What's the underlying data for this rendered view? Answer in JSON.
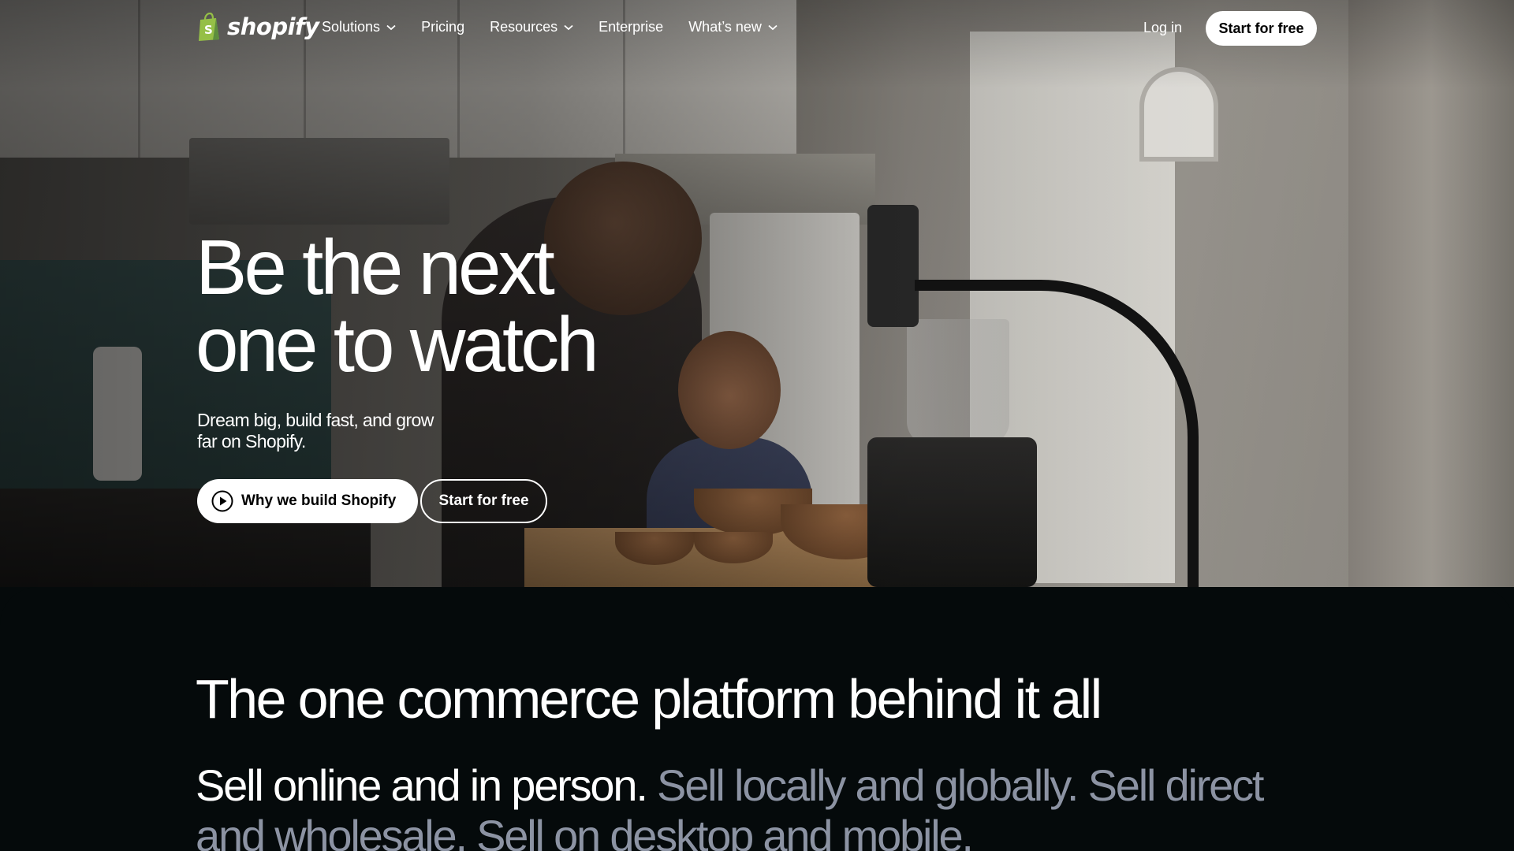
{
  "nav": {
    "logo_text": "shopify",
    "logo_icon": "shopify-bag-icon",
    "items": [
      {
        "label": "Solutions",
        "has_dropdown": true
      },
      {
        "label": "Pricing",
        "has_dropdown": false
      },
      {
        "label": "Resources",
        "has_dropdown": true
      },
      {
        "label": "Enterprise",
        "has_dropdown": false
      },
      {
        "label": "What’s new",
        "has_dropdown": true
      }
    ],
    "login_label": "Log in",
    "cta_label": "Start for free"
  },
  "hero": {
    "title_line1": "Be the next",
    "title_line2": "one to watch",
    "subtitle": "Dream big, build fast, and grow far on Shopify.",
    "primary_button_label": "Why we build Shopify",
    "primary_button_icon": "play-circle-icon",
    "secondary_button_label": "Start for free"
  },
  "platform": {
    "title": "The one commerce platform behind it all",
    "lead_strong": "Sell online and in person.",
    "lead_muted": " Sell locally and globally. Sell direct and wholesale. Sell on desktop and mobile."
  },
  "colors": {
    "brand_green": "#95bf47",
    "dark_bg": "#050a0b",
    "muted_text": "#8c93a3"
  }
}
